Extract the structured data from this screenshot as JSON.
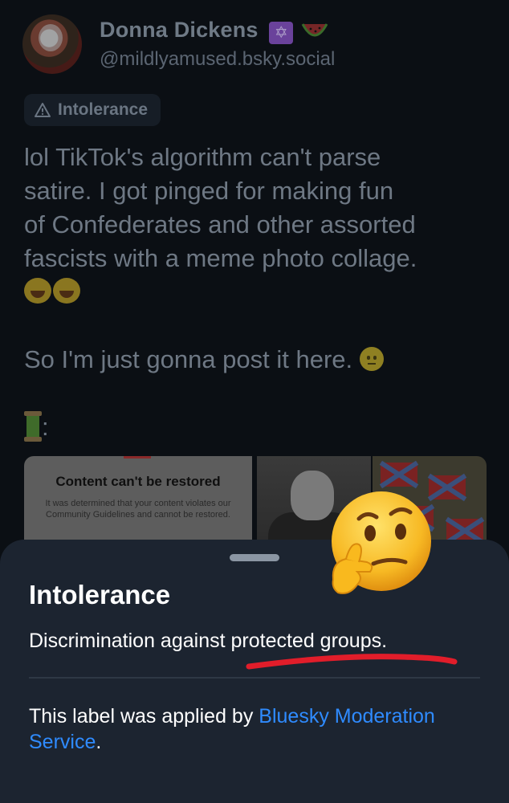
{
  "post": {
    "display_name": "Donna Dickens",
    "handle": "@mildlyamused.bsky.social",
    "label_chip": "Intolerance",
    "text_lines": [
      "lol TikTok's algorithm can't parse",
      "satire. I got pinged for making fun",
      "of Confederates and other assorted",
      "fascists with a meme photo collage."
    ],
    "text_line2": "So I'm just gonna post it here.",
    "thread_suffix": ":",
    "images": {
      "tiktok_title": "Content can't be restored",
      "tiktok_body": "It was determined that your content violates our Community Guidelines and cannot be restored."
    }
  },
  "sheet": {
    "title": "Intolerance",
    "description": "Discrimination against protected groups.",
    "applied_prefix": "This label was applied by ",
    "applied_link": "Bluesky Moderation Service",
    "applied_suffix": "."
  },
  "icons": {
    "name_badges": [
      "star-of-david-icon",
      "watermelon-icon"
    ],
    "label_chip_icon": "warning-triangle-icon",
    "overlay": "thinking-face-emoji"
  },
  "colors": {
    "sheet_bg": "#1c2430",
    "link": "#2f8bff",
    "underline": "#e11d2a",
    "page_bg": "#0b0f14"
  }
}
